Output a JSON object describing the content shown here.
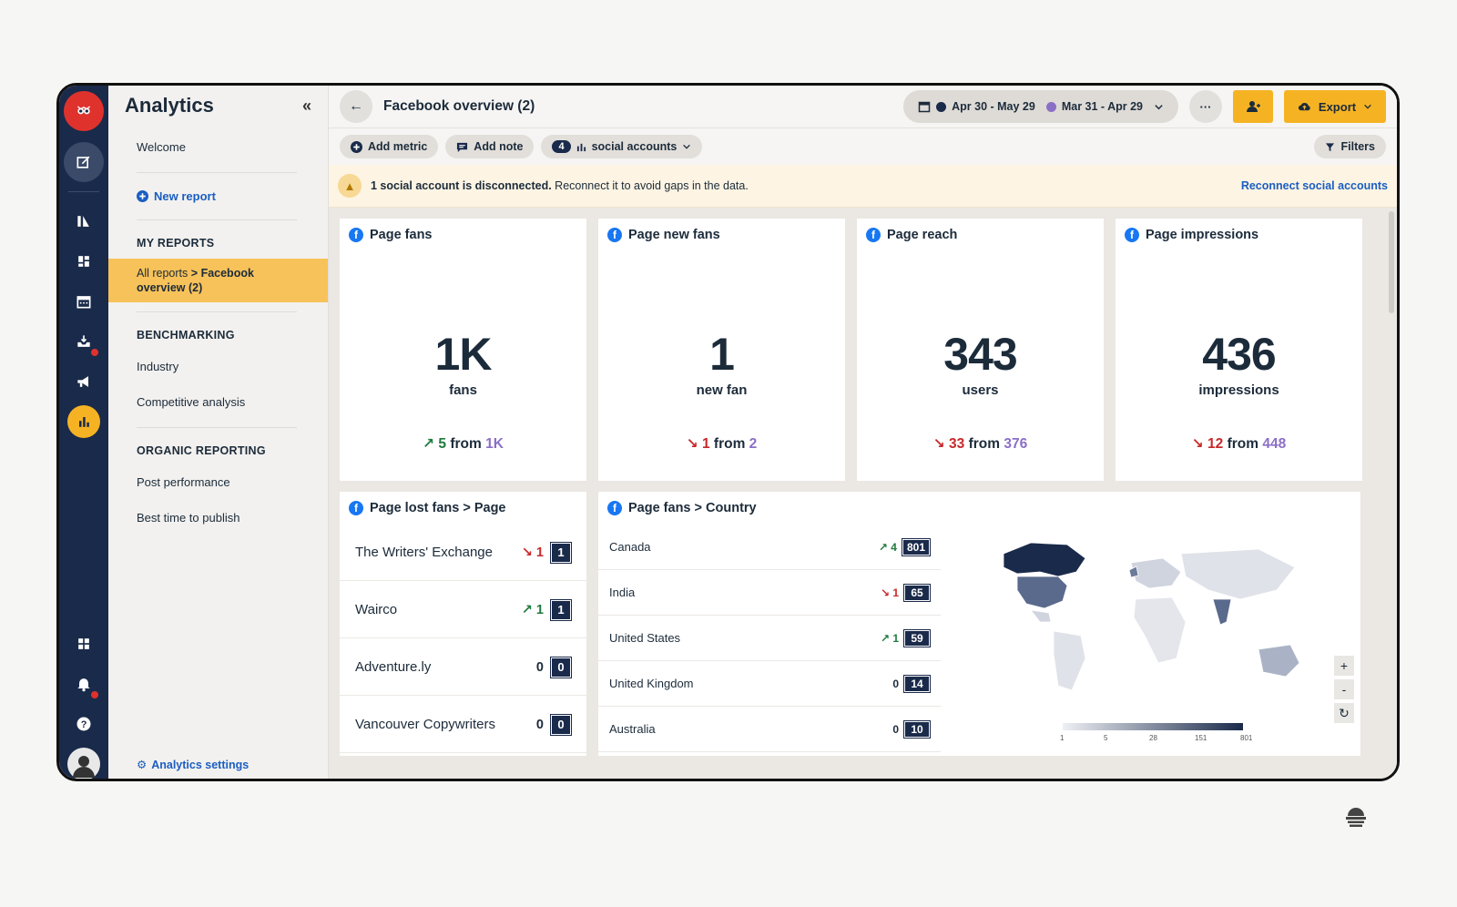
{
  "app": {
    "title": "Analytics",
    "collapse_icon": "«"
  },
  "nav": {
    "welcome": "Welcome",
    "new_report": "New report",
    "my_reports_heading": "MY REPORTS",
    "selected_prefix": "All reports",
    "selected_sep": ">",
    "selected_name": "Facebook overview (2)",
    "benchmarking_heading": "BENCHMARKING",
    "industry": "Industry",
    "competitive": "Competitive analysis",
    "organic_heading": "ORGANIC REPORTING",
    "post_performance": "Post performance",
    "best_time": "Best time to publish",
    "settings": "Analytics settings"
  },
  "header": {
    "back_icon": "←",
    "title": "Facebook overview (2)",
    "date_current": "Apr 30 - May 29",
    "date_previous": "Mar 31 - Apr 29",
    "more": "···",
    "export": "Export"
  },
  "toolbar": {
    "add_metric": "Add metric",
    "add_note": "Add note",
    "accounts_count": "4",
    "accounts_label": "social accounts",
    "filters": "Filters"
  },
  "alert": {
    "bold": "1 social account is disconnected.",
    "text": "Reconnect it to avoid gaps in the data.",
    "link": "Reconnect social accounts"
  },
  "metrics": [
    {
      "title": "Page fans",
      "value": "1K",
      "unit": "fans",
      "direction": "up",
      "change": "5",
      "from": "from",
      "previous": "1K"
    },
    {
      "title": "Page new fans",
      "value": "1",
      "unit": "new fan",
      "direction": "down",
      "change": "1",
      "from": "from",
      "previous": "2"
    },
    {
      "title": "Page reach",
      "value": "343",
      "unit": "users",
      "direction": "down",
      "change": "33",
      "from": "from",
      "previous": "376"
    },
    {
      "title": "Page impressions",
      "value": "436",
      "unit": "impressions",
      "direction": "down",
      "change": "12",
      "from": "from",
      "previous": "448"
    }
  ],
  "lost_fans": {
    "title": "Page lost fans > Page",
    "rows": [
      {
        "name": "The Writers' Exchange",
        "direction": "down",
        "change": "1",
        "value": "1"
      },
      {
        "name": "Wairco",
        "direction": "up",
        "change": "1",
        "value": "1"
      },
      {
        "name": "Adventure.ly",
        "direction": "none",
        "change": "0",
        "value": "0"
      },
      {
        "name": "Vancouver Copywriters",
        "direction": "none",
        "change": "0",
        "value": "0"
      }
    ]
  },
  "country": {
    "title": "Page fans > Country",
    "rows": [
      {
        "name": "Canada",
        "direction": "up",
        "change": "4",
        "value": "801"
      },
      {
        "name": "India",
        "direction": "down",
        "change": "1",
        "value": "65"
      },
      {
        "name": "United States",
        "direction": "up",
        "change": "1",
        "value": "59"
      },
      {
        "name": "United Kingdom",
        "direction": "none",
        "change": "0",
        "value": "14"
      },
      {
        "name": "Australia",
        "direction": "none",
        "change": "0",
        "value": "10"
      }
    ],
    "legend": [
      "1",
      "5",
      "28",
      "151",
      "801"
    ],
    "zoom_in": "+",
    "zoom_out": "-",
    "reset": "↻"
  },
  "colors": {
    "rail": "#1a2a4a",
    "accent": "#f5b324",
    "link": "#1b5ec2",
    "up": "#1f7a3e",
    "down": "#c8282a",
    "previous": "#8a6fc6"
  }
}
